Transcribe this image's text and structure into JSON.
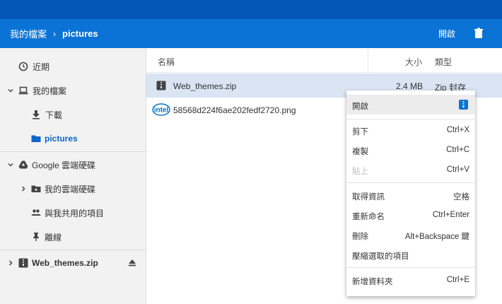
{
  "header": {
    "breadcrumb_root": "我的檔案",
    "breadcrumb_current": "pictures",
    "open_label": "開啟"
  },
  "sidebar": {
    "items": [
      {
        "label": "近期"
      },
      {
        "label": "我的檔案"
      },
      {
        "label": "下載"
      },
      {
        "label": "pictures"
      },
      {
        "label": "Google 雲端硬碟"
      },
      {
        "label": "我的雲端硬碟"
      },
      {
        "label": "與我共用的項目"
      },
      {
        "label": "離線"
      },
      {
        "label": "Web_themes.zip"
      }
    ]
  },
  "columns": {
    "name": "名稱",
    "size": "大小",
    "type": "類型"
  },
  "files": [
    {
      "name": "Web_themes.zip",
      "size": "2.4 MB",
      "type": "Zip 封存"
    },
    {
      "name": "58568d224f6ae202fedf2720.png",
      "size": "",
      "type": ""
    }
  ],
  "menu": {
    "items": [
      {
        "label": "開啟",
        "shortcut": ""
      },
      {
        "label": "剪下",
        "shortcut": "Ctrl+X"
      },
      {
        "label": "複製",
        "shortcut": "Ctrl+C"
      },
      {
        "label": "貼上",
        "shortcut": "Ctrl+V"
      },
      {
        "label": "取得資訊",
        "shortcut": "空格"
      },
      {
        "label": "重新命名",
        "shortcut": "Ctrl+Enter"
      },
      {
        "label": "刪除",
        "shortcut": "Alt+Backspace 鍵"
      },
      {
        "label": "壓縮選取的項目",
        "shortcut": ""
      },
      {
        "label": "新增資料夾",
        "shortcut": "Ctrl+E"
      }
    ]
  },
  "icons": {
    "intel_logo_text": "intel"
  },
  "colors": {
    "header_bg": "#0b73d6",
    "top_strip": "#0456b4",
    "selected_row": "#dae4f3",
    "accent": "#0b66c8"
  }
}
